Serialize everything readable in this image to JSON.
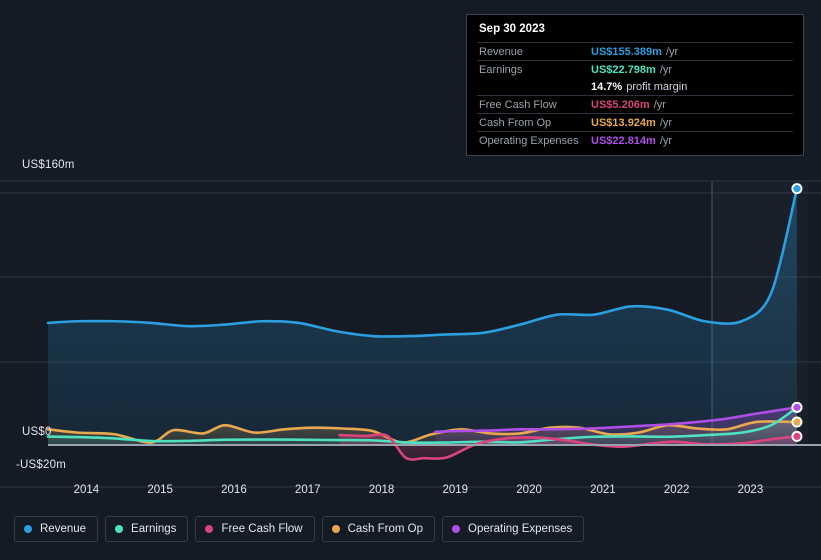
{
  "chart_data": {
    "type": "area",
    "title": "",
    "xlabel": "",
    "ylabel": "",
    "ylim": [
      -20,
      160
    ],
    "grid": true,
    "legend_position": "bottom",
    "y_axis_ticks": [
      "US$160m",
      "US$0",
      "-US$20m"
    ],
    "x_axis_ticks": [
      "2014",
      "2015",
      "2016",
      "2017",
      "2018",
      "2019",
      "2020",
      "2021",
      "2022",
      "2023"
    ],
    "x_range": [
      2013.6,
      2023.9
    ],
    "forecast_divider_x": 2022.6,
    "series": [
      {
        "name": "Revenue",
        "color": "#2b9fe0",
        "x": [
          2013.6,
          2014.0,
          2014.5,
          2015.0,
          2015.5,
          2016.0,
          2016.5,
          2017.0,
          2017.5,
          2018.0,
          2018.5,
          2019.0,
          2019.5,
          2020.0,
          2020.5,
          2021.0,
          2021.5,
          2022.0,
          2022.5,
          2023.0,
          2023.4,
          2023.75
        ],
        "values": [
          74,
          75,
          75,
          74,
          72,
          73,
          75,
          74,
          69,
          66,
          66,
          67,
          68,
          73,
          79,
          79,
          84,
          82,
          75,
          75,
          92,
          155.389
        ]
      },
      {
        "name": "Earnings",
        "color": "#4fe0c0",
        "x": [
          2013.6,
          2014.0,
          2014.5,
          2015.0,
          2015.5,
          2016.0,
          2016.5,
          2017.0,
          2017.5,
          2018.0,
          2018.5,
          2019.0,
          2019.5,
          2020.0,
          2020.5,
          2021.0,
          2021.5,
          2022.0,
          2022.5,
          2023.0,
          2023.4,
          2023.75
        ],
        "values": [
          5.1,
          4.8,
          4.0,
          2.4,
          2.5,
          3.2,
          3.3,
          3.2,
          3.0,
          2.8,
          1.5,
          1.5,
          2.0,
          1.6,
          3.6,
          5.0,
          5.2,
          5.0,
          6.0,
          7.5,
          12.0,
          22.798
        ]
      },
      {
        "name": "Free Cash Flow",
        "color": "#d9447e",
        "x": [
          2017.55,
          2017.9,
          2018.2,
          2018.45,
          2018.7,
          2019.0,
          2019.4,
          2019.8,
          2020.2,
          2020.6,
          2021.0,
          2021.4,
          2021.8,
          2022.1,
          2022.5,
          2023.0,
          2023.4,
          2023.75
        ],
        "values": [
          6.0,
          5.5,
          5.5,
          -7.8,
          -8.0,
          -7.6,
          0.5,
          4.0,
          4.5,
          3.0,
          0.2,
          -1.0,
          1.0,
          2.0,
          0.5,
          1.0,
          3.5,
          5.206
        ]
      },
      {
        "name": "Cash From Op",
        "color": "#e8a84f",
        "x": [
          2013.6,
          2014.0,
          2014.5,
          2015.0,
          2015.3,
          2015.7,
          2016.0,
          2016.4,
          2016.8,
          2017.2,
          2017.6,
          2018.0,
          2018.4,
          2018.8,
          2019.2,
          2019.6,
          2020.0,
          2020.4,
          2020.8,
          2021.2,
          2021.6,
          2022.0,
          2022.4,
          2022.8,
          2023.2,
          2023.75
        ],
        "values": [
          9.5,
          7.5,
          6.5,
          1.5,
          9.0,
          7.0,
          12.0,
          7.5,
          9.5,
          10.5,
          10.0,
          8.5,
          1.5,
          6.5,
          9.5,
          7.0,
          7.0,
          10.5,
          10.5,
          6.5,
          7.5,
          12.0,
          10.0,
          9.5,
          14.0,
          13.924
        ]
      },
      {
        "name": "Operating Expenses",
        "color": "#b04ee8",
        "x": [
          2018.85,
          2019.2,
          2019.6,
          2020.0,
          2020.4,
          2020.8,
          2021.2,
          2021.6,
          2022.0,
          2022.4,
          2022.8,
          2023.2,
          2023.75
        ],
        "values": [
          8.0,
          8.5,
          8.8,
          9.5,
          9.5,
          9.8,
          10.5,
          11.5,
          12.5,
          14.0,
          16.0,
          19.0,
          22.814
        ]
      }
    ]
  },
  "tooltip": {
    "date": "Sep 30 2023",
    "rows": [
      {
        "label": "Revenue",
        "value": "US$155.389m",
        "unit": "/yr",
        "color": "#2b9fe0",
        "sub": ""
      },
      {
        "label": "Earnings",
        "value": "US$22.798m",
        "unit": "/yr",
        "color": "#4fe0c0",
        "sub": ""
      },
      {
        "label": "",
        "value": "14.7%",
        "unit": "",
        "color": "#ffffff",
        "sub": "profit margin"
      },
      {
        "label": "Free Cash Flow",
        "value": "US$5.206m",
        "unit": "/yr",
        "color": "#d9447e",
        "sub": ""
      },
      {
        "label": "Cash From Op",
        "value": "US$13.924m",
        "unit": "/yr",
        "color": "#e8a84f",
        "sub": ""
      },
      {
        "label": "Operating Expenses",
        "value": "US$22.814m",
        "unit": "/yr",
        "color": "#b04ee8",
        "sub": ""
      }
    ]
  },
  "legend": {
    "items": [
      {
        "label": "Revenue",
        "color": "#2b9fe0"
      },
      {
        "label": "Earnings",
        "color": "#4fe0c0"
      },
      {
        "label": "Free Cash Flow",
        "color": "#d9447e"
      },
      {
        "label": "Cash From Op",
        "color": "#e8a84f"
      },
      {
        "label": "Operating Expenses",
        "color": "#b04ee8"
      }
    ]
  },
  "theme": {
    "background": "#151b24",
    "gridline": "#2b3440",
    "zero_line": "#9aa3ad",
    "axis_text": "#dfe6ee"
  }
}
